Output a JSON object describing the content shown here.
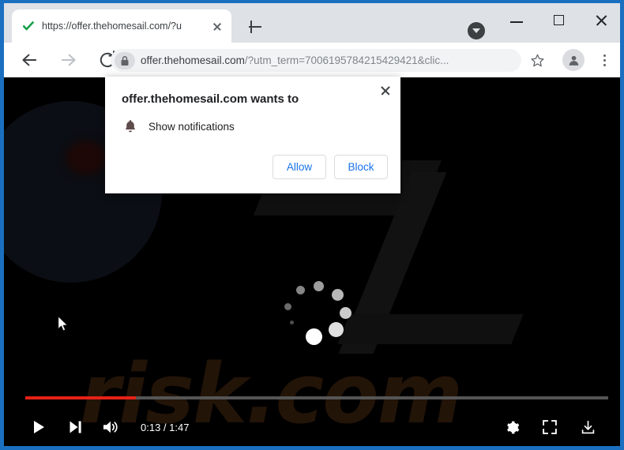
{
  "window": {
    "frame_color": "#1a6fc0",
    "controls": {
      "minimize_label": "Minimize",
      "maximize_label": "Maximize",
      "close_label": "Close",
      "profile_chip_label": "Profile"
    }
  },
  "tab": {
    "title": "https://offer.thehomesail.com/?u",
    "favicon": "green-check-icon",
    "close_label": "Close tab",
    "new_tab_label": "New tab"
  },
  "toolbar": {
    "back_label": "Back",
    "forward_label": "Forward",
    "reload_label": "Reload",
    "lock_icon": "lock-icon",
    "url_main": "offer.thehomesail.com",
    "url_query": "/?utm_term=7006195784215429421&clic...",
    "bookmark_label": "Bookmark this tab",
    "avatar_label": "Profile",
    "menu_label": "Customize and control Google Chrome"
  },
  "permission_dialog": {
    "title": "offer.thehomesail.com wants to",
    "bell_icon": "bell-icon",
    "permission_label": "Show notifications",
    "allow_label": "Allow",
    "block_label": "Block",
    "close_label": "Close",
    "accent_color": "#1a73e8"
  },
  "player": {
    "background_color": "#000000",
    "watermark_text": "risk.com",
    "watermark_color": "#231408",
    "spinner": "loading-spinner",
    "progress": {
      "played_percent": 19,
      "played_color": "#e62117",
      "track_color": "#555555"
    },
    "play_label": "Play",
    "next_label": "Next",
    "volume_label": "Mute",
    "time_display": "0:13 / 1:47",
    "current_time": "0:13",
    "duration": "1:47",
    "settings_label": "Settings",
    "fullscreen_label": "Full screen",
    "download_label": "Download"
  }
}
